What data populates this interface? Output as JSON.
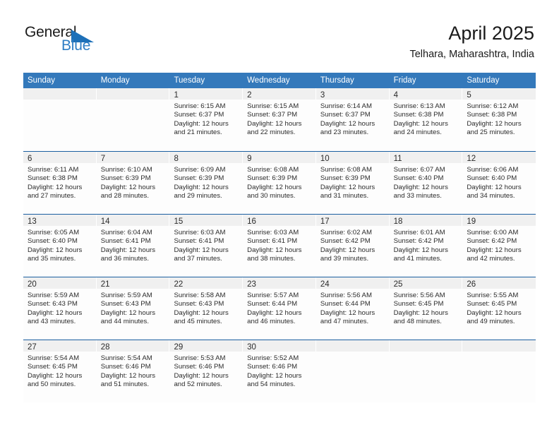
{
  "brand": {
    "name_part1": "General",
    "name_part2": "Blue",
    "logo_icon": "blue-triangle-icon",
    "accent_color": "#2e7dc4"
  },
  "header": {
    "title": "April 2025",
    "subtitle": "Telhara, Maharashtra, India"
  },
  "theme": {
    "header_bg": "#3479bb",
    "row_divider": "#1b5fa0",
    "day_band_bg": "#f0f0f0",
    "cell_bg": "#fdfdfd"
  },
  "weekdays": [
    "Sunday",
    "Monday",
    "Tuesday",
    "Wednesday",
    "Thursday",
    "Friday",
    "Saturday"
  ],
  "weeks": [
    [
      {
        "day": "",
        "sunrise": "",
        "sunset": "",
        "daylight_line1": "",
        "daylight_line2": ""
      },
      {
        "day": "",
        "sunrise": "",
        "sunset": "",
        "daylight_line1": "",
        "daylight_line2": ""
      },
      {
        "day": "1",
        "sunrise": "Sunrise: 6:15 AM",
        "sunset": "Sunset: 6:37 PM",
        "daylight_line1": "Daylight: 12 hours",
        "daylight_line2": "and 21 minutes."
      },
      {
        "day": "2",
        "sunrise": "Sunrise: 6:15 AM",
        "sunset": "Sunset: 6:37 PM",
        "daylight_line1": "Daylight: 12 hours",
        "daylight_line2": "and 22 minutes."
      },
      {
        "day": "3",
        "sunrise": "Sunrise: 6:14 AM",
        "sunset": "Sunset: 6:37 PM",
        "daylight_line1": "Daylight: 12 hours",
        "daylight_line2": "and 23 minutes."
      },
      {
        "day": "4",
        "sunrise": "Sunrise: 6:13 AM",
        "sunset": "Sunset: 6:38 PM",
        "daylight_line1": "Daylight: 12 hours",
        "daylight_line2": "and 24 minutes."
      },
      {
        "day": "5",
        "sunrise": "Sunrise: 6:12 AM",
        "sunset": "Sunset: 6:38 PM",
        "daylight_line1": "Daylight: 12 hours",
        "daylight_line2": "and 25 minutes."
      }
    ],
    [
      {
        "day": "6",
        "sunrise": "Sunrise: 6:11 AM",
        "sunset": "Sunset: 6:38 PM",
        "daylight_line1": "Daylight: 12 hours",
        "daylight_line2": "and 27 minutes."
      },
      {
        "day": "7",
        "sunrise": "Sunrise: 6:10 AM",
        "sunset": "Sunset: 6:39 PM",
        "daylight_line1": "Daylight: 12 hours",
        "daylight_line2": "and 28 minutes."
      },
      {
        "day": "8",
        "sunrise": "Sunrise: 6:09 AM",
        "sunset": "Sunset: 6:39 PM",
        "daylight_line1": "Daylight: 12 hours",
        "daylight_line2": "and 29 minutes."
      },
      {
        "day": "9",
        "sunrise": "Sunrise: 6:08 AM",
        "sunset": "Sunset: 6:39 PM",
        "daylight_line1": "Daylight: 12 hours",
        "daylight_line2": "and 30 minutes."
      },
      {
        "day": "10",
        "sunrise": "Sunrise: 6:08 AM",
        "sunset": "Sunset: 6:39 PM",
        "daylight_line1": "Daylight: 12 hours",
        "daylight_line2": "and 31 minutes."
      },
      {
        "day": "11",
        "sunrise": "Sunrise: 6:07 AM",
        "sunset": "Sunset: 6:40 PM",
        "daylight_line1": "Daylight: 12 hours",
        "daylight_line2": "and 33 minutes."
      },
      {
        "day": "12",
        "sunrise": "Sunrise: 6:06 AM",
        "sunset": "Sunset: 6:40 PM",
        "daylight_line1": "Daylight: 12 hours",
        "daylight_line2": "and 34 minutes."
      }
    ],
    [
      {
        "day": "13",
        "sunrise": "Sunrise: 6:05 AM",
        "sunset": "Sunset: 6:40 PM",
        "daylight_line1": "Daylight: 12 hours",
        "daylight_line2": "and 35 minutes."
      },
      {
        "day": "14",
        "sunrise": "Sunrise: 6:04 AM",
        "sunset": "Sunset: 6:41 PM",
        "daylight_line1": "Daylight: 12 hours",
        "daylight_line2": "and 36 minutes."
      },
      {
        "day": "15",
        "sunrise": "Sunrise: 6:03 AM",
        "sunset": "Sunset: 6:41 PM",
        "daylight_line1": "Daylight: 12 hours",
        "daylight_line2": "and 37 minutes."
      },
      {
        "day": "16",
        "sunrise": "Sunrise: 6:03 AM",
        "sunset": "Sunset: 6:41 PM",
        "daylight_line1": "Daylight: 12 hours",
        "daylight_line2": "and 38 minutes."
      },
      {
        "day": "17",
        "sunrise": "Sunrise: 6:02 AM",
        "sunset": "Sunset: 6:42 PM",
        "daylight_line1": "Daylight: 12 hours",
        "daylight_line2": "and 39 minutes."
      },
      {
        "day": "18",
        "sunrise": "Sunrise: 6:01 AM",
        "sunset": "Sunset: 6:42 PM",
        "daylight_line1": "Daylight: 12 hours",
        "daylight_line2": "and 41 minutes."
      },
      {
        "day": "19",
        "sunrise": "Sunrise: 6:00 AM",
        "sunset": "Sunset: 6:42 PM",
        "daylight_line1": "Daylight: 12 hours",
        "daylight_line2": "and 42 minutes."
      }
    ],
    [
      {
        "day": "20",
        "sunrise": "Sunrise: 5:59 AM",
        "sunset": "Sunset: 6:43 PM",
        "daylight_line1": "Daylight: 12 hours",
        "daylight_line2": "and 43 minutes."
      },
      {
        "day": "21",
        "sunrise": "Sunrise: 5:59 AM",
        "sunset": "Sunset: 6:43 PM",
        "daylight_line1": "Daylight: 12 hours",
        "daylight_line2": "and 44 minutes."
      },
      {
        "day": "22",
        "sunrise": "Sunrise: 5:58 AM",
        "sunset": "Sunset: 6:43 PM",
        "daylight_line1": "Daylight: 12 hours",
        "daylight_line2": "and 45 minutes."
      },
      {
        "day": "23",
        "sunrise": "Sunrise: 5:57 AM",
        "sunset": "Sunset: 6:44 PM",
        "daylight_line1": "Daylight: 12 hours",
        "daylight_line2": "and 46 minutes."
      },
      {
        "day": "24",
        "sunrise": "Sunrise: 5:56 AM",
        "sunset": "Sunset: 6:44 PM",
        "daylight_line1": "Daylight: 12 hours",
        "daylight_line2": "and 47 minutes."
      },
      {
        "day": "25",
        "sunrise": "Sunrise: 5:56 AM",
        "sunset": "Sunset: 6:45 PM",
        "daylight_line1": "Daylight: 12 hours",
        "daylight_line2": "and 48 minutes."
      },
      {
        "day": "26",
        "sunrise": "Sunrise: 5:55 AM",
        "sunset": "Sunset: 6:45 PM",
        "daylight_line1": "Daylight: 12 hours",
        "daylight_line2": "and 49 minutes."
      }
    ],
    [
      {
        "day": "27",
        "sunrise": "Sunrise: 5:54 AM",
        "sunset": "Sunset: 6:45 PM",
        "daylight_line1": "Daylight: 12 hours",
        "daylight_line2": "and 50 minutes."
      },
      {
        "day": "28",
        "sunrise": "Sunrise: 5:54 AM",
        "sunset": "Sunset: 6:46 PM",
        "daylight_line1": "Daylight: 12 hours",
        "daylight_line2": "and 51 minutes."
      },
      {
        "day": "29",
        "sunrise": "Sunrise: 5:53 AM",
        "sunset": "Sunset: 6:46 PM",
        "daylight_line1": "Daylight: 12 hours",
        "daylight_line2": "and 52 minutes."
      },
      {
        "day": "30",
        "sunrise": "Sunrise: 5:52 AM",
        "sunset": "Sunset: 6:46 PM",
        "daylight_line1": "Daylight: 12 hours",
        "daylight_line2": "and 54 minutes."
      },
      {
        "day": "",
        "sunrise": "",
        "sunset": "",
        "daylight_line1": "",
        "daylight_line2": ""
      },
      {
        "day": "",
        "sunrise": "",
        "sunset": "",
        "daylight_line1": "",
        "daylight_line2": ""
      },
      {
        "day": "",
        "sunrise": "",
        "sunset": "",
        "daylight_line1": "",
        "daylight_line2": ""
      }
    ]
  ]
}
